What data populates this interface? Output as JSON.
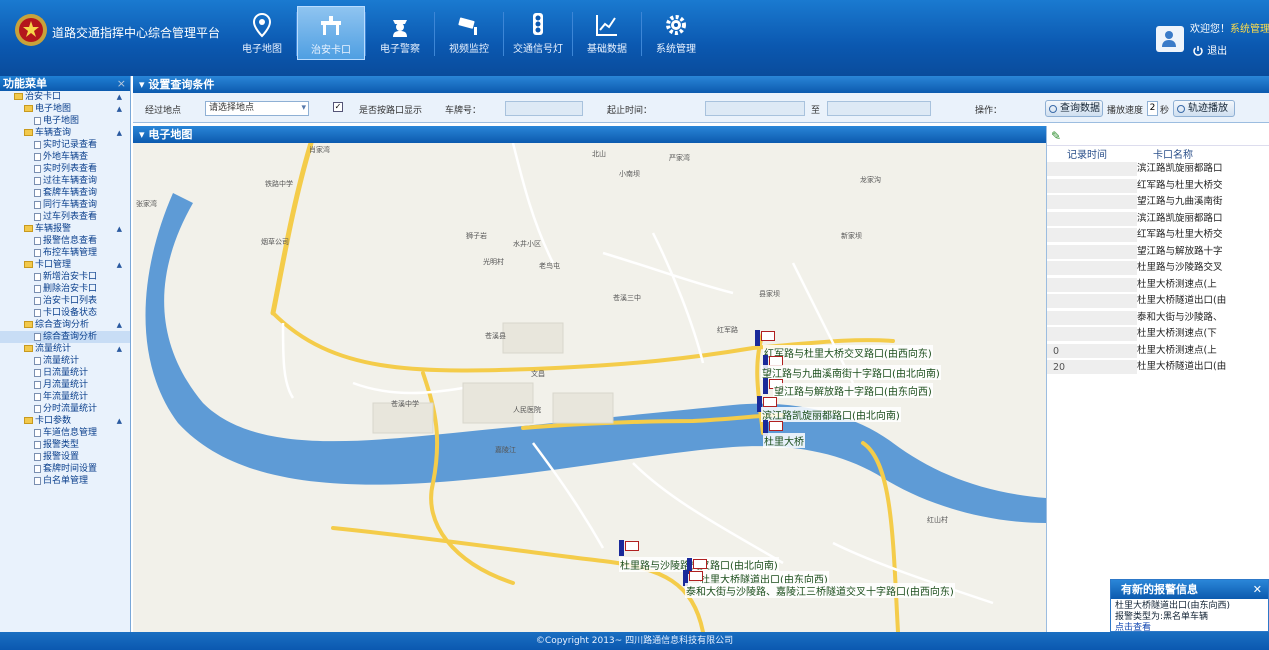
{
  "header": {
    "app_title": "道路交通指挥中心综合管理平台",
    "welcome_prefix": "欢迎您！",
    "welcome_user": "系统管理员",
    "logout_label": "退出"
  },
  "nav": [
    {
      "label": "电子地图",
      "icon": "map-pin-icon"
    },
    {
      "label": "治安卡口",
      "icon": "checkpoint-icon",
      "active": true
    },
    {
      "label": "电子警察",
      "icon": "police-icon"
    },
    {
      "label": "视频监控",
      "icon": "camera-icon"
    },
    {
      "label": "交通信号灯",
      "icon": "traffic-light-icon"
    },
    {
      "label": "基础数据",
      "icon": "chart-icon"
    },
    {
      "label": "系统管理",
      "icon": "gear-icon"
    }
  ],
  "sidebar": {
    "title": "功能菜单",
    "close": "×",
    "tree": [
      {
        "label": "治安卡口",
        "level": 0,
        "type": "folder",
        "arrow": "▲"
      },
      {
        "label": "电子地图",
        "level": 1,
        "type": "folder",
        "arrow": "▲"
      },
      {
        "label": "电子地图",
        "level": 2,
        "type": "leaf"
      },
      {
        "label": "车辆查询",
        "level": 1,
        "type": "folder",
        "arrow": "▲"
      },
      {
        "label": "实时记录查看",
        "level": 2,
        "type": "leaf"
      },
      {
        "label": "外地车辆查",
        "level": 2,
        "type": "leaf"
      },
      {
        "label": "实时列表查看",
        "level": 2,
        "type": "leaf"
      },
      {
        "label": "过往车辆查询",
        "level": 2,
        "type": "leaf"
      },
      {
        "label": "套牌车辆查询",
        "level": 2,
        "type": "leaf"
      },
      {
        "label": "同行车辆查询",
        "level": 2,
        "type": "leaf"
      },
      {
        "label": "过车列表查看",
        "level": 2,
        "type": "leaf"
      },
      {
        "label": "车辆报警",
        "level": 1,
        "type": "folder",
        "arrow": "▲"
      },
      {
        "label": "报警信息查看",
        "level": 2,
        "type": "leaf"
      },
      {
        "label": "布控车辆管理",
        "level": 2,
        "type": "leaf"
      },
      {
        "label": "卡口管理",
        "level": 1,
        "type": "folder",
        "arrow": "▲"
      },
      {
        "label": "新增治安卡口",
        "level": 2,
        "type": "leaf"
      },
      {
        "label": "删除治安卡口",
        "level": 2,
        "type": "leaf"
      },
      {
        "label": "治安卡口列表",
        "level": 2,
        "type": "leaf"
      },
      {
        "label": "卡口设备状态",
        "level": 2,
        "type": "leaf"
      },
      {
        "label": "综合查询分析",
        "level": 1,
        "type": "folder",
        "arrow": "▲"
      },
      {
        "label": "综合查询分析",
        "level": 2,
        "type": "leaf",
        "selected": true
      },
      {
        "label": "流量统计",
        "level": 1,
        "type": "folder",
        "arrow": "▲"
      },
      {
        "label": "流量统计",
        "level": 2,
        "type": "leaf"
      },
      {
        "label": "日流量统计",
        "level": 2,
        "type": "leaf"
      },
      {
        "label": "月流量统计",
        "level": 2,
        "type": "leaf"
      },
      {
        "label": "年流量统计",
        "level": 2,
        "type": "leaf"
      },
      {
        "label": "分时流量统计",
        "level": 2,
        "type": "leaf"
      },
      {
        "label": "卡口参数",
        "level": 1,
        "type": "folder",
        "arrow": "▲"
      },
      {
        "label": "车道信息管理",
        "level": 2,
        "type": "leaf"
      },
      {
        "label": "报警类型",
        "level": 2,
        "type": "leaf"
      },
      {
        "label": "报警设置",
        "level": 2,
        "type": "leaf"
      },
      {
        "label": "套牌时间设置",
        "level": 2,
        "type": "leaf"
      },
      {
        "label": "白名单管理",
        "level": 2,
        "type": "leaf"
      }
    ]
  },
  "query": {
    "title": "设置查询条件",
    "location_label": "经过地点",
    "location_value": "请选择地点",
    "checkbox_label": "是否按路口显示",
    "plate_label": "车牌号：",
    "time_label": "起止时间：",
    "time_sep": "至",
    "op_label": "操作：",
    "query_btn": "查询数据",
    "speed_label": "播放速度",
    "speed_value": "2",
    "speed_unit": "秒",
    "play_btn": "轨迹播放"
  },
  "map": {
    "title": "电子地图",
    "markers": [
      {
        "label": "红军路与杜里大桥交叉路口(由西向东)"
      },
      {
        "label": "望江路与九曲溪南街十字路口(由北向南)"
      },
      {
        "label": "望江路与解放路十字路口(由东向西)"
      },
      {
        "label": "滨江路凯旋丽都路口(由北向南)"
      },
      {
        "label": "杜里大桥"
      },
      {
        "label": "杜里路与沙陵路交叉路口(由北向南)"
      },
      {
        "label": "杜里大桥隧道出口(由东向西)"
      },
      {
        "label": "泰和大街与沙陵路、嘉陵江三桥隧道交叉十字路口(由西向东)"
      }
    ],
    "places": [
      "肖家湾",
      "北山",
      "严家湾",
      "小南坝",
      "龙家沟",
      "新家坝",
      "县家坝",
      "铁路中学",
      "苍溪县",
      "烟草公司",
      "狮子岩",
      "水井小区",
      "老鸟屯",
      "红军路",
      "人民医院",
      "嘉陵江",
      "张家湾",
      "苍溪中学",
      "文昌",
      "光明村",
      "红山村",
      "苍溪三中"
    ]
  },
  "records": {
    "col_time": "记录时间",
    "col_name": "卡口名称",
    "rows": [
      {
        "time": "",
        "name": "滨江路凯旋丽都路口"
      },
      {
        "time": "",
        "name": "红军路与杜里大桥交"
      },
      {
        "time": "",
        "name": "望江路与九曲溪南街"
      },
      {
        "time": "",
        "name": "滨江路凯旋丽都路口"
      },
      {
        "time": "",
        "name": "红军路与杜里大桥交"
      },
      {
        "time": "",
        "name": "望江路与解放路十字"
      },
      {
        "time": "",
        "name": "杜里路与沙陵路交叉"
      },
      {
        "time": "",
        "name": "杜里大桥测速点(上"
      },
      {
        "time": "",
        "name": "杜里大桥隧道出口(由"
      },
      {
        "time": "",
        "name": "泰和大街与沙陵路、"
      },
      {
        "time": "",
        "name": "杜里大桥测速点(下"
      },
      {
        "time": "0",
        "name": "杜里大桥测速点(上"
      },
      {
        "time": "20",
        "name": "杜里大桥隧道出口(由"
      }
    ]
  },
  "alert": {
    "title": "有新的报警信息",
    "close": "✕",
    "line1": "杜里大桥隧道出口(由东向西)",
    "line2": "报警类型为:黑名单车辆",
    "link": "点击查看"
  },
  "footer": {
    "text": "©Copyright 2013~ 四川路通信息科技有限公司"
  }
}
